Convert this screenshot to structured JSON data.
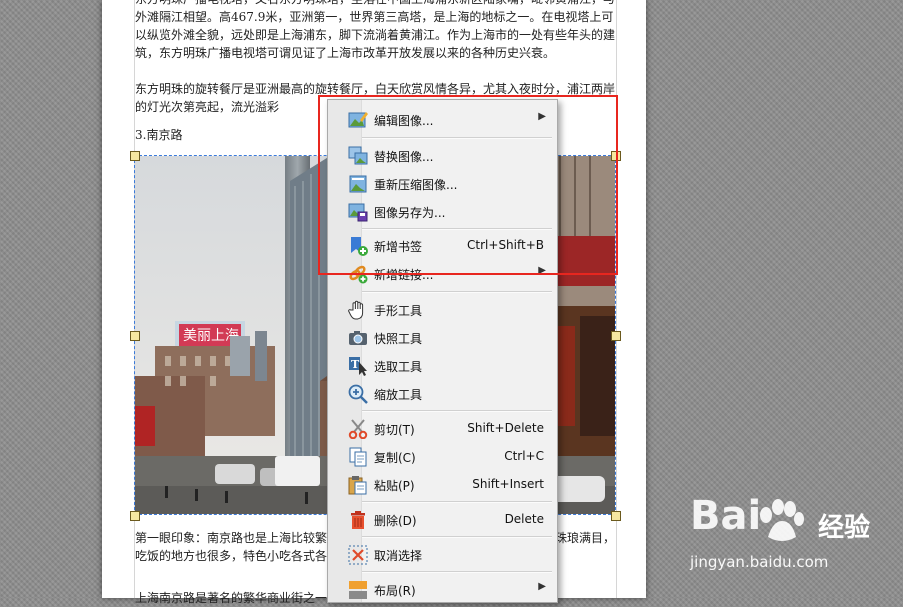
{
  "document": {
    "para1": "东方明珠广播电视塔，又名东方明珠塔，坐落在中国上海浦东新区陆家嘴，毗邻黄浦江，与外滩隔江相望。高467.9米，亚洲第一，世界第三高塔，是上海的地标之一。在电视塔上可以纵览外滩全貌，远处即是上海浦东，脚下流淌着黄浦江。作为上海市的一处有些年头的建筑，东方明珠广播电视塔可谓见证了上海市改革开放发展以来的各种历史兴衰。",
    "para2": "东方明珠的旋转餐厅是亚洲最高的旋转餐厅，白天欣赏风情各异，尤其入夜时分，浦江两岸的灯光次第亮起，流光溢彩",
    "heading": "3.南京路",
    "para3": "第一眼印象：南京路也是上海比较繁华的街道，商店林立，人来人往，算得上是珠琅满目，吃饭的地方也很多，特色小吃各式各样，去看看帅哥美女也是很不错的。",
    "para4": "上海南京路是著名的繁华商业街之一，这里",
    "photo_sign": "美丽上海"
  },
  "context_menu": {
    "items": [
      {
        "label": "编辑图像...",
        "shortcut": "",
        "submenu": true,
        "icon": "edit-image-icon"
      },
      {
        "label": "替换图像...",
        "shortcut": "",
        "submenu": false,
        "icon": "replace-image-icon"
      },
      {
        "label": "重新压缩图像...",
        "shortcut": "",
        "submenu": false,
        "icon": "recompress-image-icon"
      },
      {
        "label": "图像另存为...",
        "shortcut": "",
        "submenu": false,
        "icon": "save-image-as-icon"
      },
      {
        "label": "新增书签",
        "shortcut": "Ctrl+Shift+B",
        "submenu": false,
        "icon": "add-bookmark-icon"
      },
      {
        "label": "新增链接...",
        "shortcut": "",
        "submenu": true,
        "icon": "add-link-icon"
      },
      {
        "label": "手形工具",
        "shortcut": "",
        "submenu": false,
        "icon": "hand-tool-icon"
      },
      {
        "label": "快照工具",
        "shortcut": "",
        "submenu": false,
        "icon": "snapshot-tool-icon"
      },
      {
        "label": "选取工具",
        "shortcut": "",
        "submenu": false,
        "icon": "select-tool-icon"
      },
      {
        "label": "缩放工具",
        "shortcut": "",
        "submenu": false,
        "icon": "zoom-tool-icon"
      },
      {
        "label": "剪切(T)",
        "shortcut": "Shift+Delete",
        "submenu": false,
        "icon": "scissors-icon"
      },
      {
        "label": "复制(C)",
        "shortcut": "Ctrl+C",
        "submenu": false,
        "icon": "copy-icon"
      },
      {
        "label": "粘贴(P)",
        "shortcut": "Shift+Insert",
        "submenu": false,
        "icon": "paste-icon"
      },
      {
        "label": "删除(D)",
        "shortcut": "Delete",
        "submenu": false,
        "icon": "trash-icon"
      },
      {
        "label": "取消选择",
        "shortcut": "",
        "submenu": false,
        "icon": "deselect-icon"
      },
      {
        "label": "布局(R)",
        "shortcut": "",
        "submenu": true,
        "icon": "layout-icon"
      }
    ]
  },
  "watermark": {
    "logo": "Bai",
    "brand": "经验",
    "url": "jingyan.baidu.com"
  },
  "colors": {
    "highlight_border": "#e8261f",
    "selection_border": "#3b7ad9"
  }
}
